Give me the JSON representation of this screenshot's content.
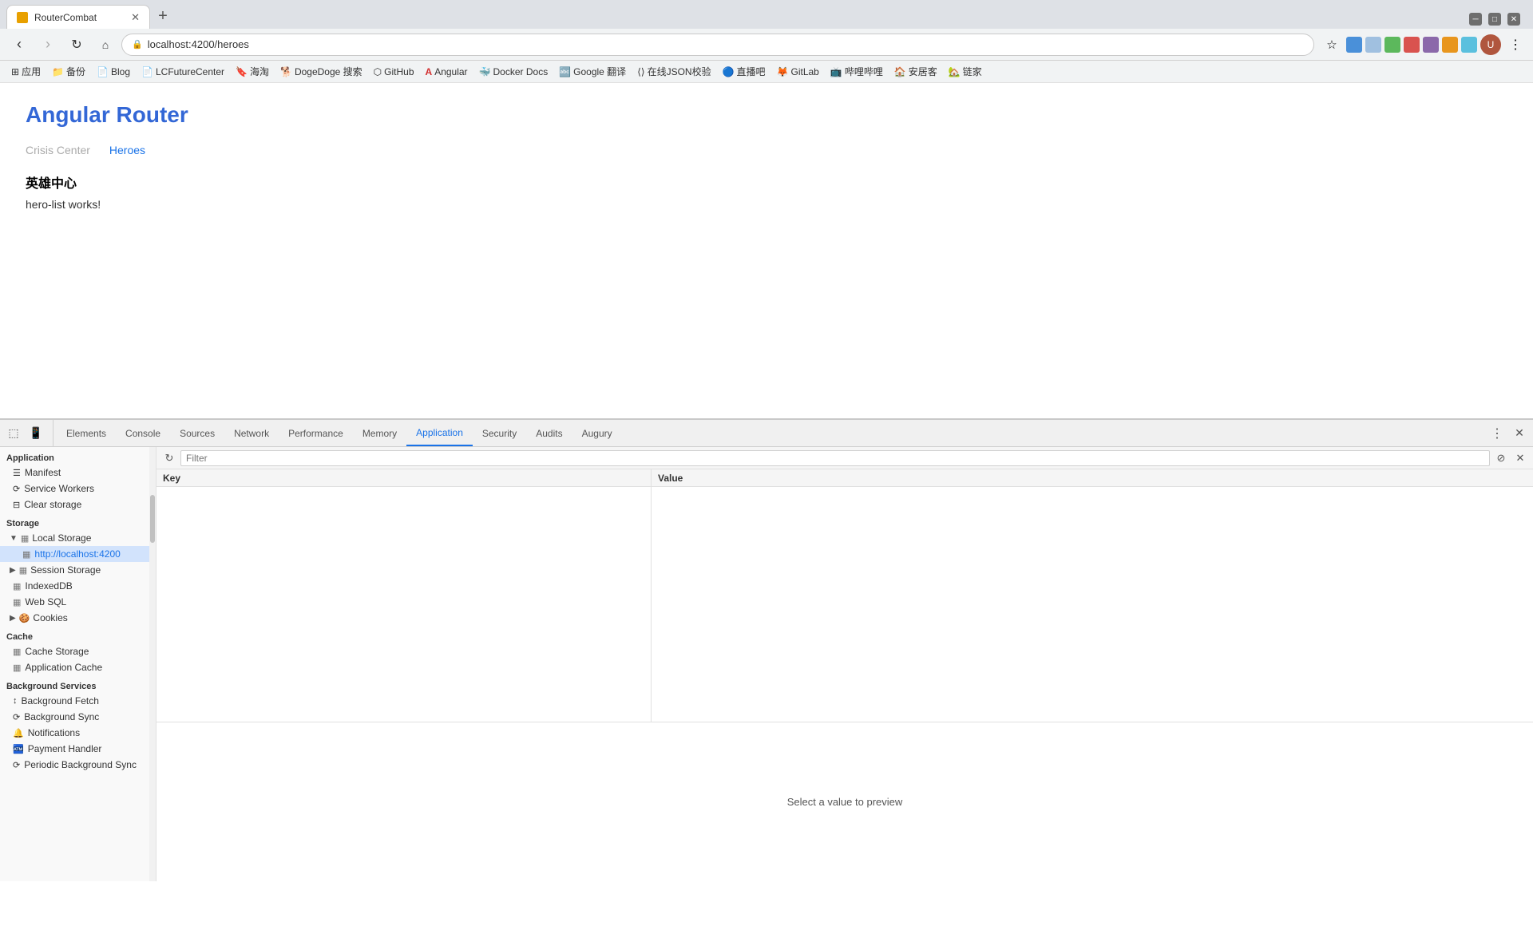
{
  "browser": {
    "tab_title": "RouterCombat",
    "url": "localhost:4200/heroes",
    "new_tab_label": "+",
    "back_disabled": false,
    "forward_disabled": true
  },
  "bookmarks": [
    {
      "label": "应用",
      "icon": "⊞"
    },
    {
      "label": "备份",
      "icon": "📁"
    },
    {
      "label": "Blog",
      "icon": "📄"
    },
    {
      "label": "LCFutureCenter",
      "icon": "📄"
    },
    {
      "label": "海淘",
      "icon": "🔖"
    },
    {
      "label": "DogeDoge 搜索",
      "icon": "🐕"
    },
    {
      "label": "GitHub",
      "icon": "⬡"
    },
    {
      "label": "Angular",
      "icon": "🅐"
    },
    {
      "label": "Docker Docs",
      "icon": "🐳"
    },
    {
      "label": "Google 翻译",
      "icon": "🔤"
    },
    {
      "label": "在线JSON校验",
      "icon": "⟨⟩"
    },
    {
      "label": "直播吧",
      "icon": "🔵"
    },
    {
      "label": "GitLab",
      "icon": "🦊"
    },
    {
      "label": "哔哩哔哩",
      "icon": "📺"
    },
    {
      "label": "安居客",
      "icon": "🏠"
    },
    {
      "label": "链家",
      "icon": "🏡"
    }
  ],
  "page": {
    "title": "Angular Router",
    "nav_links": [
      {
        "label": "Crisis Center",
        "active": false
      },
      {
        "label": "Heroes",
        "active": true
      }
    ],
    "section_heading": "英雄中心",
    "section_text": "hero-list works!"
  },
  "devtools": {
    "tabs": [
      {
        "label": "Elements",
        "active": false
      },
      {
        "label": "Console",
        "active": false
      },
      {
        "label": "Sources",
        "active": false
      },
      {
        "label": "Network",
        "active": false
      },
      {
        "label": "Performance",
        "active": false
      },
      {
        "label": "Memory",
        "active": false
      },
      {
        "label": "Application",
        "active": true
      },
      {
        "label": "Security",
        "active": false
      },
      {
        "label": "Audits",
        "active": false
      },
      {
        "label": "Augury",
        "active": false
      }
    ],
    "sidebar": {
      "sections": [
        {
          "label": "Application",
          "items": [
            {
              "label": "Manifest",
              "icon": "☰",
              "indented": 1
            },
            {
              "label": "Service Workers",
              "icon": "⟳",
              "indented": 1
            },
            {
              "label": "Clear storage",
              "icon": "⊟",
              "indented": 1
            }
          ]
        },
        {
          "label": "Storage",
          "items": [
            {
              "label": "Local Storage",
              "icon": "▦",
              "indented": 1,
              "expanded": true,
              "group": true
            },
            {
              "label": "http://localhost:4200",
              "icon": "▦",
              "indented": 2,
              "active": true
            },
            {
              "label": "Session Storage",
              "icon": "▦",
              "indented": 1,
              "group": true
            },
            {
              "label": "IndexedDB",
              "icon": "▦",
              "indented": 1
            },
            {
              "label": "Web SQL",
              "icon": "▦",
              "indented": 1
            },
            {
              "label": "Cookies",
              "icon": "🍪",
              "indented": 1,
              "group": true
            }
          ]
        },
        {
          "label": "Cache",
          "items": [
            {
              "label": "Cache Storage",
              "icon": "▦",
              "indented": 1
            },
            {
              "label": "Application Cache",
              "icon": "▦",
              "indented": 1
            }
          ]
        },
        {
          "label": "Background Services",
          "items": [
            {
              "label": "Background Fetch",
              "icon": "↑↓",
              "indented": 1
            },
            {
              "label": "Background Sync",
              "icon": "⟳",
              "indented": 1
            },
            {
              "label": "Notifications",
              "icon": "🔔",
              "indented": 1
            },
            {
              "label": "Payment Handler",
              "icon": "🏧",
              "indented": 1
            },
            {
              "label": "Periodic Background Sync",
              "icon": "⟳",
              "indented": 1
            }
          ]
        }
      ]
    },
    "filter_placeholder": "Filter",
    "table": {
      "columns": [
        {
          "label": "Key"
        },
        {
          "label": "Value"
        }
      ],
      "rows": []
    },
    "preview_text": "Select a value to preview"
  }
}
